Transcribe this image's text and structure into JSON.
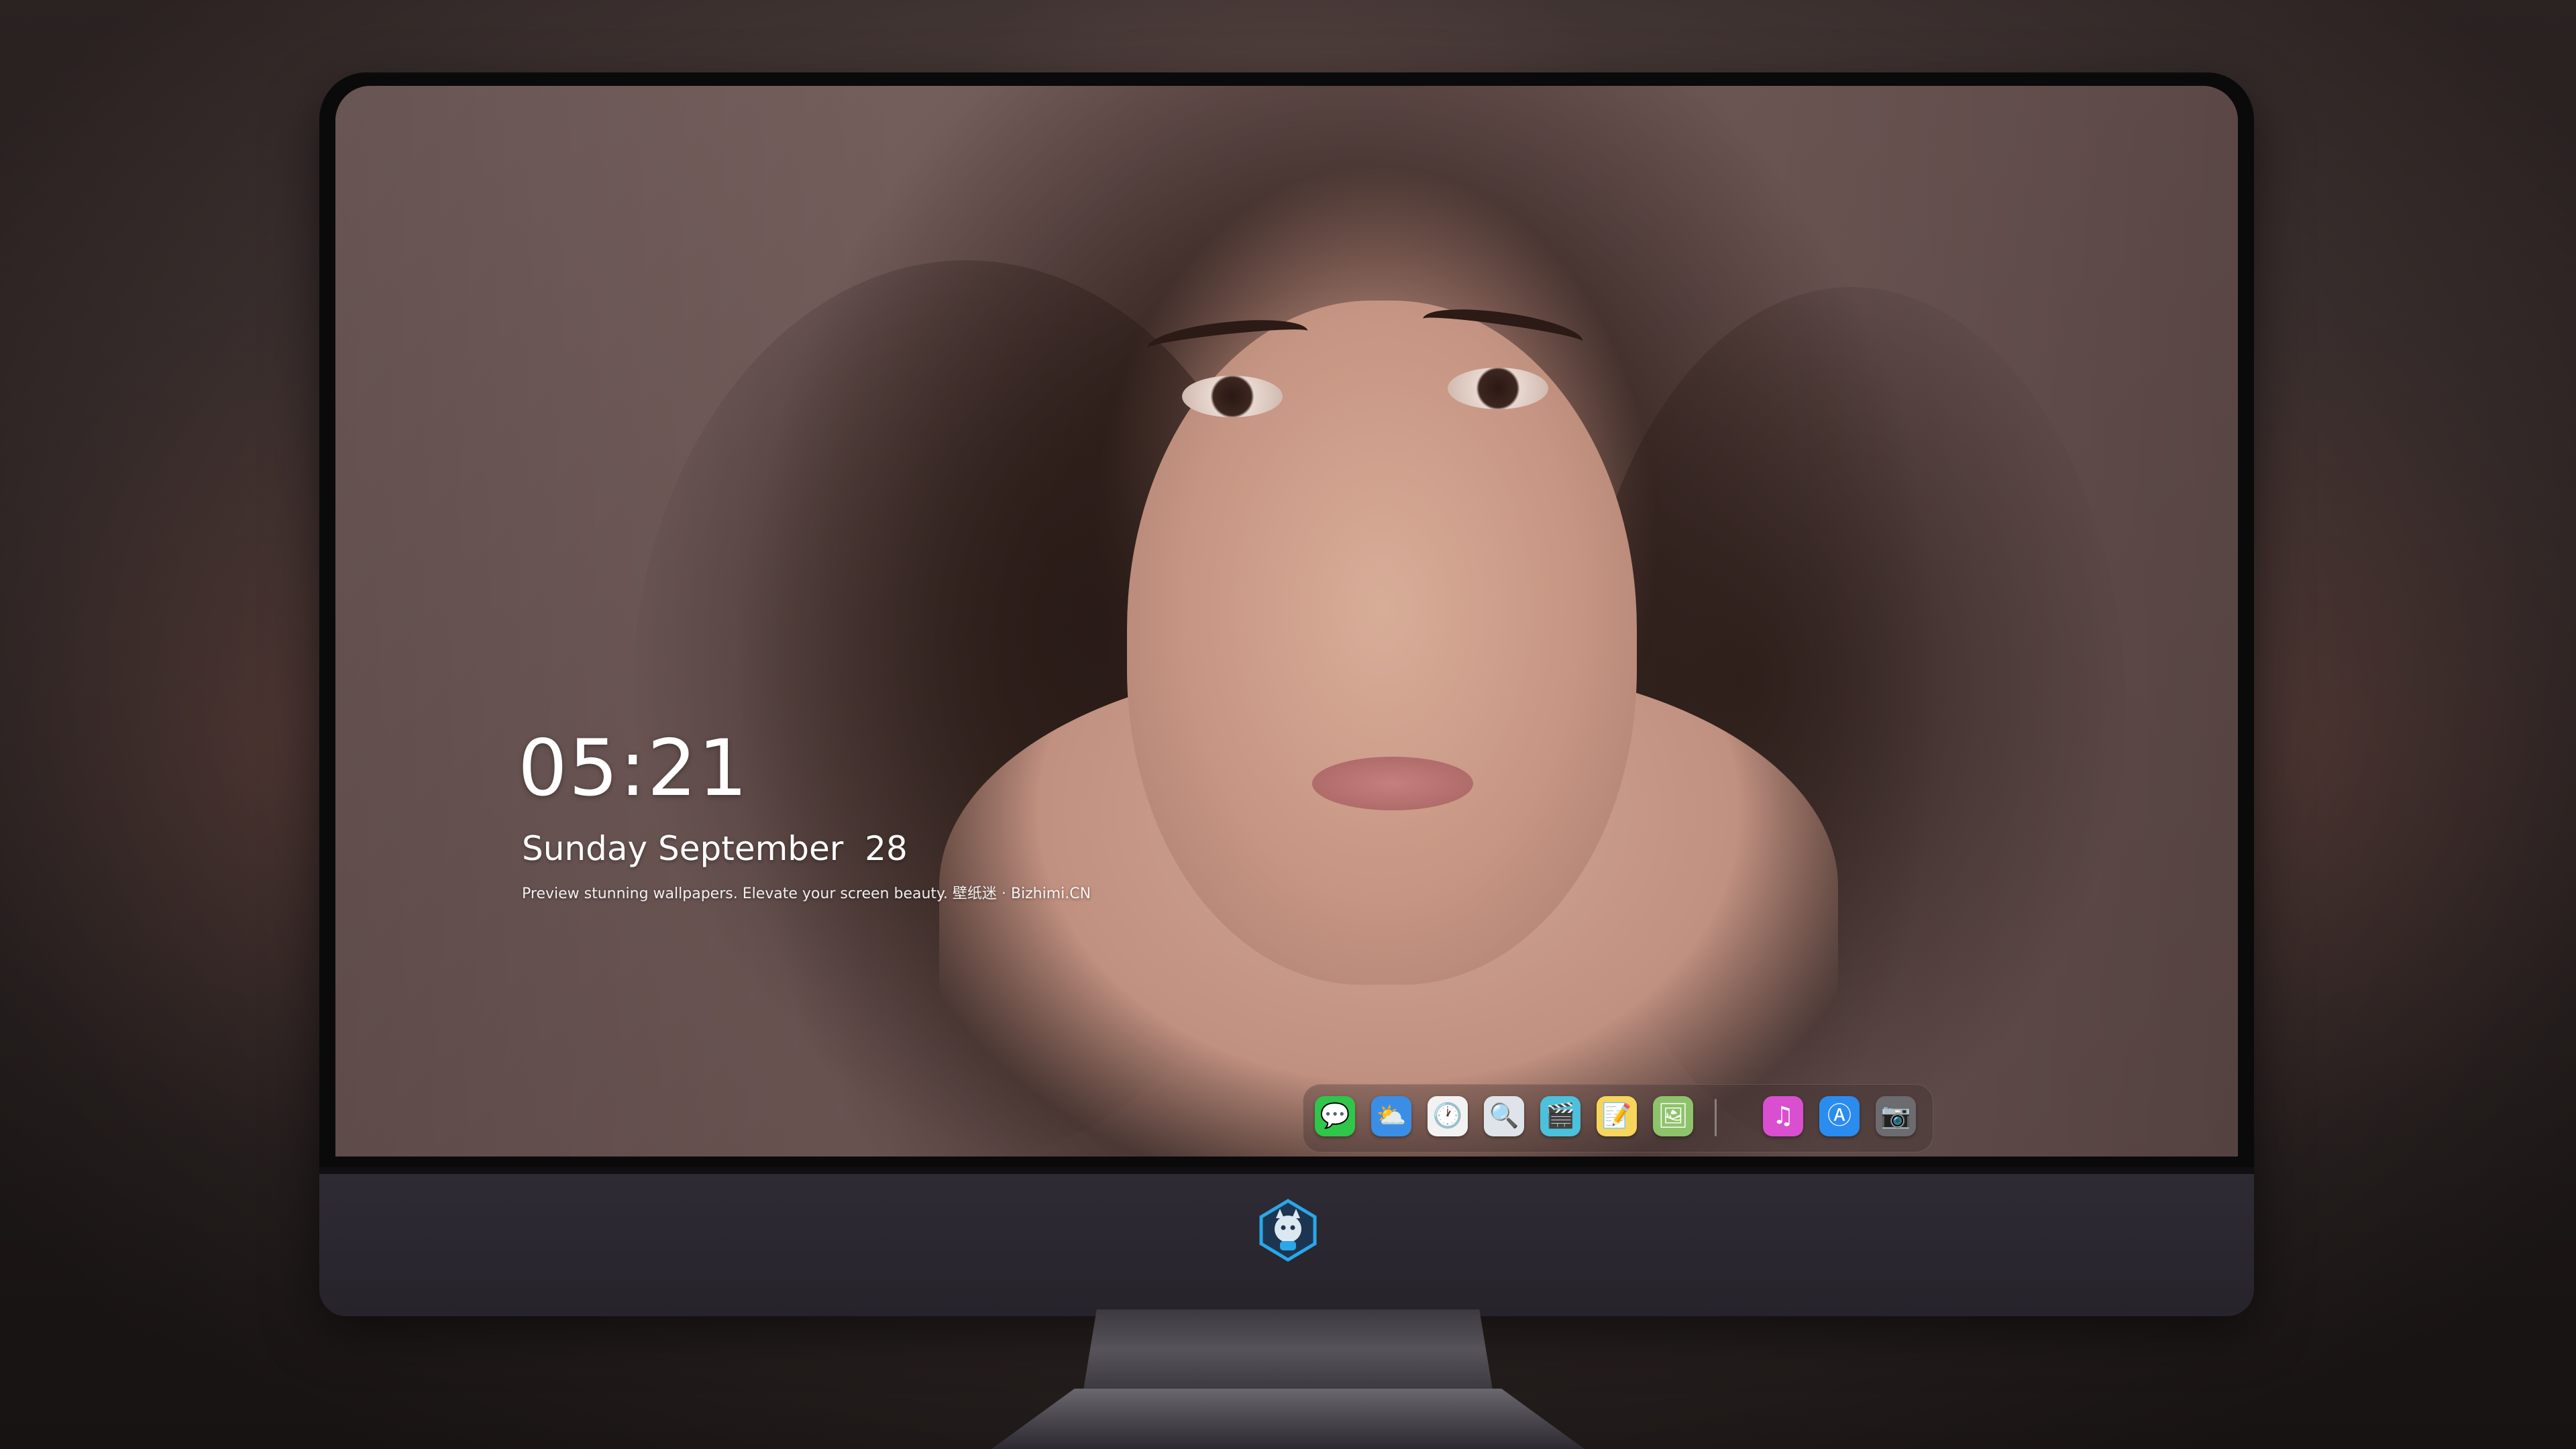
{
  "lockscreen": {
    "time": "05:21",
    "date": "Sunday September  28",
    "tagline": "Preview stunning wallpapers. Elevate your screen beauty. 壁纸迷 · Bizhimi.CN"
  },
  "dock": {
    "apps": [
      {
        "name": "messages-icon",
        "glyph": "💬",
        "color": "#2fc64a"
      },
      {
        "name": "weather-icon",
        "glyph": "⛅",
        "color": "#3a8ee6"
      },
      {
        "name": "clock-icon",
        "glyph": "🕐",
        "color": "#f2f2f2"
      },
      {
        "name": "preview-icon",
        "glyph": "🔍",
        "color": "#dfe4ea"
      },
      {
        "name": "clapper-icon",
        "glyph": "🎬",
        "color": "#4bc1dc"
      },
      {
        "name": "notes-icon",
        "glyph": "📝",
        "color": "#f6d55c"
      },
      {
        "name": "photos-icon",
        "glyph": "🖼",
        "color": "#8fc36b"
      },
      {
        "name": "music-icon",
        "glyph": "♫",
        "color": "#d94fcf"
      },
      {
        "name": "app-store-icon",
        "glyph": "Ⓐ",
        "color": "#2b8cf0"
      },
      {
        "name": "camera-icon",
        "glyph": "📷",
        "color": "#6b6b70"
      }
    ]
  },
  "colors": {
    "bezel": "#0a0a0b",
    "chin": "#2e2b34",
    "logo_accent": "#2aa7e8"
  }
}
